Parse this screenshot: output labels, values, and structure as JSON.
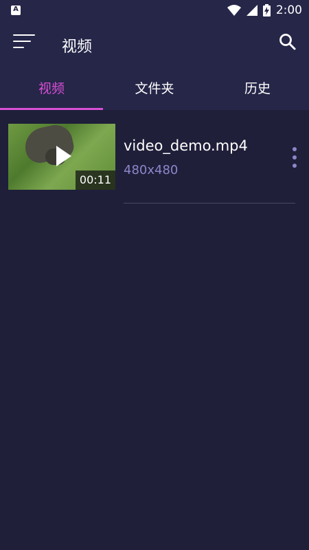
{
  "status_bar": {
    "time": "2:00",
    "notification_icon": "a-icon",
    "icons": [
      "wifi-icon",
      "signal-icon",
      "battery-charging-icon"
    ]
  },
  "app_bar": {
    "title": "视频",
    "menu_icon": "menu-icon",
    "search_icon": "search-icon"
  },
  "tabs": [
    {
      "label": "视频",
      "active": true
    },
    {
      "label": "文件夹",
      "active": false
    },
    {
      "label": "历史",
      "active": false
    }
  ],
  "videos": [
    {
      "name": "video_demo.mp4",
      "resolution": "480x480",
      "duration": "00:11"
    }
  ],
  "colors": {
    "background": "#1f1f3a",
    "bar": "#262649",
    "accent": "#d94fd6",
    "secondary_text": "#8e86c9"
  }
}
